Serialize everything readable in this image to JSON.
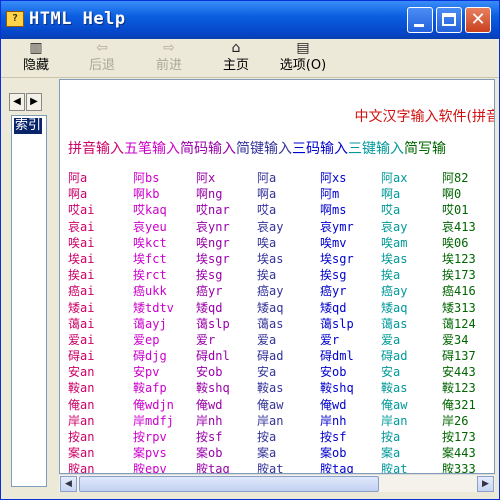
{
  "window": {
    "title": "HTML Help"
  },
  "toolbar": {
    "hide": "隐藏",
    "back": "后退",
    "forward": "前进",
    "home": "主页",
    "options": "选项(O)"
  },
  "left_pane": {
    "index_tab": "索引"
  },
  "content": {
    "heading": "中文汉字输入软件(拼音",
    "methods": [
      {
        "label": "拼音输入",
        "color": "#cc0066"
      },
      {
        "label": "五笔输入",
        "color": "#cc00cc"
      },
      {
        "label": "简码输入",
        "color": "#9900aa"
      },
      {
        "label": "简键输入",
        "color": "#333399"
      },
      {
        "label": "三码输入",
        "color": "#0000cc"
      },
      {
        "label": "三键输入",
        "color": "#009999"
      },
      {
        "label": "简写输",
        "color": "#006600"
      }
    ],
    "columns": [
      {
        "color": "#cc0066",
        "cells": [
          "阿a",
          "啊a",
          "哎ai",
          "哀ai",
          "唉ai",
          "埃ai",
          "挨ai",
          "癌ai",
          "矮ai",
          "蔼ai",
          "爱ai",
          "碍ai",
          "安an",
          "鞍an",
          "俺an",
          "岸an",
          "按an",
          "案an",
          "胺an"
        ]
      },
      {
        "color": "#cc00cc",
        "cells": [
          "阿bs",
          "啊kb",
          "哎kaq",
          "哀yeu",
          "唉kct",
          "埃fct",
          "挨rct",
          "癌ukk",
          "矮tdtv",
          "蔼ayj",
          "爱ep",
          "碍djg",
          "安pv",
          "鞍afp",
          "俺wdjn",
          "岸mdfj",
          "按rpv",
          "案pvs",
          "胺epv"
        ]
      },
      {
        "color": "#9900aa",
        "cells": [
          "阿x",
          "啊ng",
          "哎nar",
          "哀ynr",
          "唉ngr",
          "埃sgr",
          "挨sg",
          "癌yr",
          "矮qd",
          "蔼slp",
          "爱r",
          "碍dnl",
          "安ob",
          "鞍shq",
          "俺wd",
          "岸nh",
          "按sf",
          "案ob",
          "胺tag"
        ]
      },
      {
        "color": "#333399",
        "cells": [
          "阿a",
          "啊a",
          "哎a",
          "哀ay",
          "唉a",
          "埃as",
          "挨a",
          "癌ay",
          "矮aq",
          "蔼as",
          "爱a",
          "碍ad",
          "安a",
          "鞍as",
          "俺aw",
          "岸an",
          "按a",
          "案a",
          "胺at"
        ]
      },
      {
        "color": "#0000cc",
        "cells": [
          "阿xs",
          "阿m",
          "啊ms",
          "哀ymr",
          "唉mv",
          "埃sgr",
          "挨sg",
          "癌yr",
          "矮qd",
          "蔼slp",
          "爱r",
          "碍dml",
          "安ob",
          "鞍shq",
          "俺wd",
          "岸nh",
          "按sf",
          "案ob",
          "胺tag"
        ]
      },
      {
        "color": "#009999",
        "cells": [
          "阿ax",
          "啊a",
          "哎a",
          "哀ay",
          "唉am",
          "埃as",
          "挨a",
          "癌ay",
          "矮aq",
          "蔼as",
          "爱a",
          "碍ad",
          "安a",
          "鞍as",
          "俺aw",
          "岸an",
          "按a",
          "案a",
          "胺at"
        ]
      },
      {
        "color": "#006600",
        "cells": [
          "阿82",
          "啊0",
          "哎01",
          "哀413",
          "唉06",
          "埃123",
          "挨173",
          "癌416",
          "矮313",
          "蔼124",
          "爱34",
          "碍137",
          "安443",
          "鞍123",
          "俺321",
          "岸26",
          "按173",
          "案443",
          "胺333"
        ]
      }
    ]
  }
}
